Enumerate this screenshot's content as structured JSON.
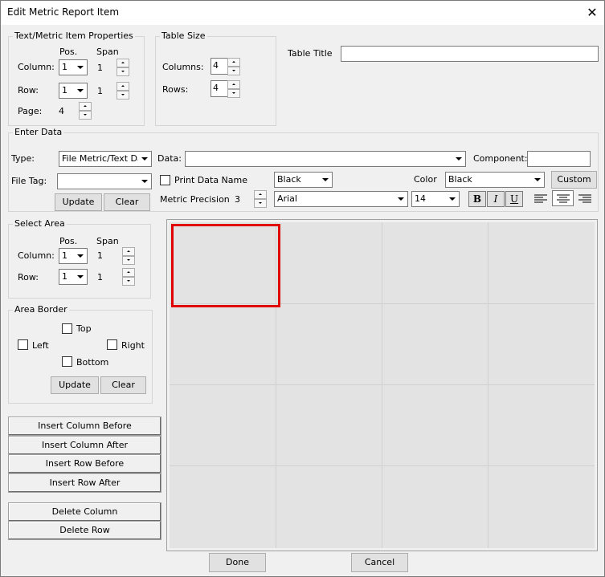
{
  "window": {
    "title": "Edit Metric Report Item",
    "close_symbol": "✕"
  },
  "props": {
    "legend": "Text/Metric Item Properties",
    "pos_header": "Pos.",
    "span_header": "Span",
    "column_label": "Column:",
    "column_pos": "1",
    "column_span": "1",
    "row_label": "Row:",
    "row_pos": "1",
    "row_span": "1",
    "page_label": "Page:",
    "page_value": "4"
  },
  "table_size": {
    "legend": "Table Size",
    "columns_label": "Columns:",
    "columns_value": "4",
    "rows_label": "Rows:",
    "rows_value": "4"
  },
  "table_title": {
    "label": "Table Title",
    "value": ""
  },
  "enter_data": {
    "legend": "Enter Data",
    "type_label": "Type:",
    "type_value": "File Metric/Text Dat",
    "data_label": "Data:",
    "data_value": "",
    "component_label": "Component:",
    "component_value": "",
    "file_tag_label": "File Tag:",
    "file_tag_value": "",
    "print_data_name_label": "Print Data Name",
    "print_data_name_checked": false,
    "bg_color_value": "Black",
    "color_label": "Color",
    "color_value": "Black",
    "custom_label": "Custom",
    "update_label": "Update",
    "clear_label": "Clear",
    "metric_precision_label": "Metric Precision",
    "metric_precision_value": "3",
    "font_value": "Arial",
    "font_size_value": "14",
    "bold_label": "B",
    "italic_label": "I",
    "underline_label": "U",
    "alignment_selected": "center"
  },
  "select_area": {
    "legend": "Select Area",
    "pos_header": "Pos.",
    "span_header": "Span",
    "column_label": "Column:",
    "column_pos": "1",
    "column_span": "1",
    "row_label": "Row:",
    "row_pos": "1",
    "row_span": "1"
  },
  "area_border": {
    "legend": "Area Border",
    "top_label": "Top",
    "left_label": "Left",
    "right_label": "Right",
    "bottom_label": "Bottom",
    "update_label": "Update",
    "clear_label": "Clear"
  },
  "actions": {
    "insert_column_before": "Insert Column Before",
    "insert_column_after": "Insert Column After",
    "insert_row_before": "Insert Row Before",
    "insert_row_after": "Insert Row After",
    "delete_column": "Delete Column",
    "delete_row": "Delete Row"
  },
  "footer": {
    "done_label": "Done",
    "cancel_label": "Cancel"
  },
  "grid": {
    "columns": 4,
    "rows": 4,
    "selected": {
      "column": 1,
      "row": 1
    },
    "selection_color": "#e00000"
  }
}
